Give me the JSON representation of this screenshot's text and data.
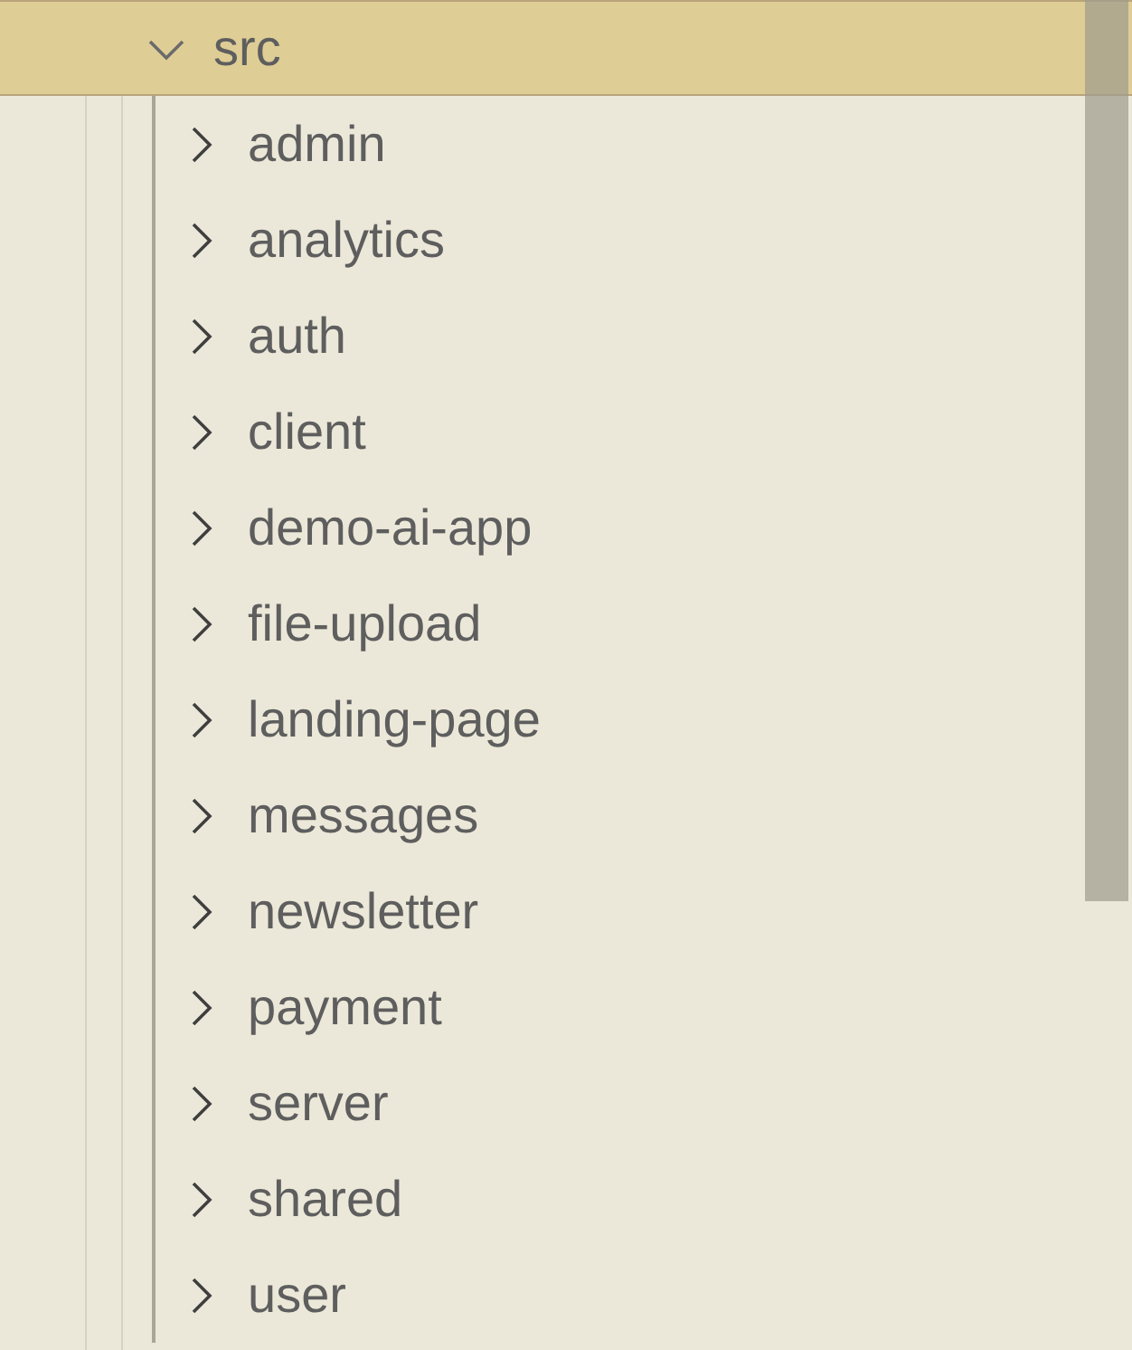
{
  "tree": [
    {
      "label": "src",
      "expanded": true,
      "selected": true,
      "children": [
        {
          "label": "admin",
          "expanded": false,
          "selected": false
        },
        {
          "label": "analytics",
          "expanded": false,
          "selected": false
        },
        {
          "label": "auth",
          "expanded": false,
          "selected": false
        },
        {
          "label": "client",
          "expanded": false,
          "selected": false
        },
        {
          "label": "demo-ai-app",
          "expanded": false,
          "selected": false
        },
        {
          "label": "file-upload",
          "expanded": false,
          "selected": false
        },
        {
          "label": "landing-page",
          "expanded": false,
          "selected": false
        },
        {
          "label": "messages",
          "expanded": false,
          "selected": false
        },
        {
          "label": "newsletter",
          "expanded": false,
          "selected": false
        },
        {
          "label": "payment",
          "expanded": false,
          "selected": false
        },
        {
          "label": "server",
          "expanded": false,
          "selected": false
        },
        {
          "label": "shared",
          "expanded": false,
          "selected": false
        },
        {
          "label": "user",
          "expanded": false,
          "selected": false
        }
      ]
    }
  ]
}
